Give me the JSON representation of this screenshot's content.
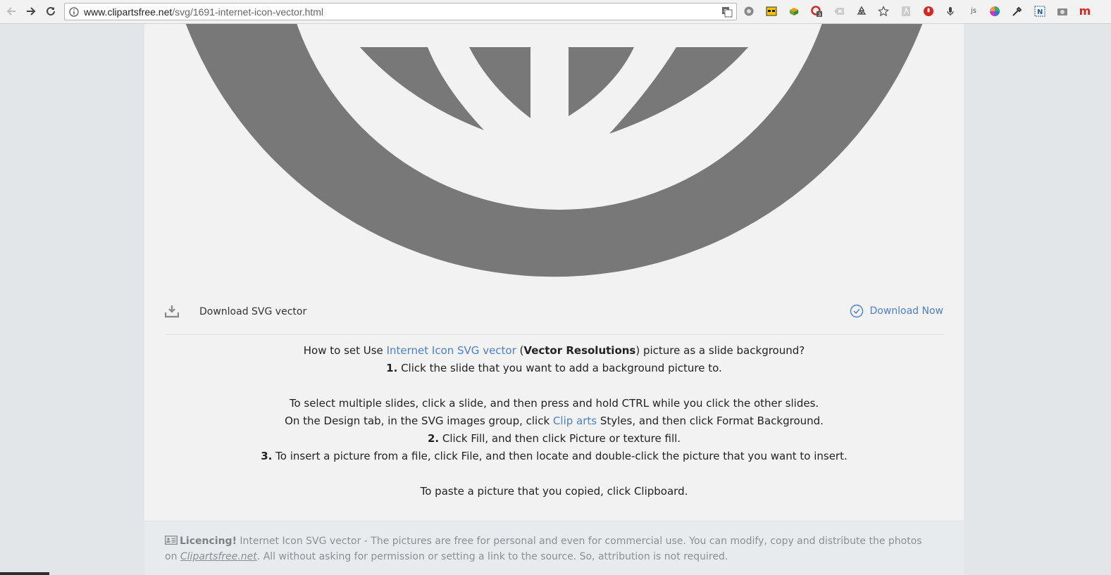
{
  "browser": {
    "url_host": "www.clipartsfree.net",
    "url_path": "/svg/1691-internet-icon-vector.html",
    "extension_badge": "3",
    "extension_js_label": "js",
    "extension_m_label": "m"
  },
  "download": {
    "label": "Download SVG vector",
    "button": "Download Now"
  },
  "howto": {
    "intro_prefix": "How to set Use ",
    "intro_link": "Internet Icon SVG vector",
    "intro_open": " (",
    "intro_bold": "Vector Resolutions",
    "intro_suffix": ") picture as a slide background?",
    "step1_num": "1.",
    "step1_text": " Click the slide that you want to add a background picture to.",
    "multi_select": "To select multiple slides, click a slide, and then press and hold CTRL while you click the other slides.",
    "design_prefix": "On the Design tab, in the SVG images group, click ",
    "design_link": "Clip arts",
    "design_suffix": " Styles, and then click Format Background.",
    "step2_num": "2.",
    "step2_text": " Click Fill, and then click Picture or texture fill.",
    "step3_num": "3.",
    "step3_text": " To insert a picture from a file, click File, and then locate and double-click the picture that you want to insert.",
    "paste": "To paste a picture that you copied, click Clipboard."
  },
  "licence": {
    "title": "Licencing!",
    "text1": " Internet Icon SVG vector - The pictures are free for personal and even for commercial use. You can modify, copy and distribute the photos on ",
    "site": "Clipartsfree.net",
    "text2": ". All without asking for permission or setting a link to the source. So, attribution is not required."
  },
  "colors": {
    "icon_gray": "#787878",
    "link_blue": "#4a80c9",
    "page_bg": "#f2f2f2",
    "side_bg": "#e2e6e8"
  },
  "icons": [
    "back-arrow-icon",
    "forward-arrow-icon",
    "reload-icon",
    "info-icon",
    "translate-icon",
    "bookmark-star-icon",
    "download-icon",
    "check-circle-icon",
    "id-card-icon"
  ]
}
